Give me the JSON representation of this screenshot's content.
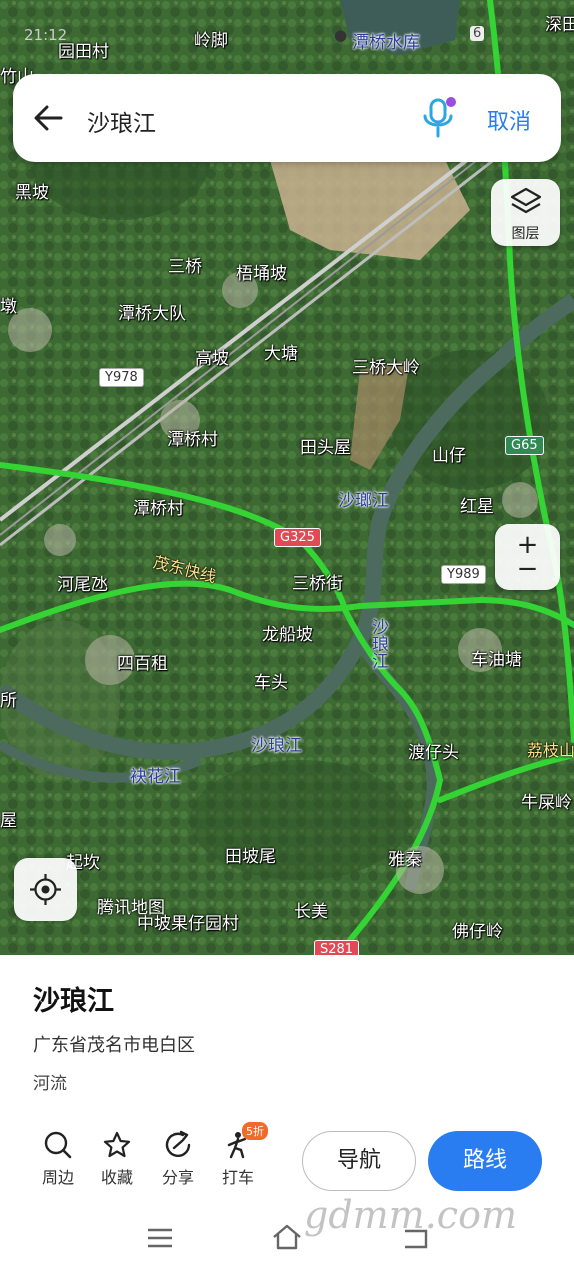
{
  "status_bar": {
    "time": "21:12",
    "carrier_label": "潭桥水库",
    "battery": "6"
  },
  "search": {
    "query": "沙琅江",
    "cancel_label": "取消"
  },
  "map_controls": {
    "layers_label": "图层",
    "zoom_in_symbol": "+",
    "zoom_out_symbol": "−",
    "watermark": "腾讯地图"
  },
  "map_labels": {
    "places": [
      "园田村",
      "岭脚",
      "深田",
      "竹山",
      "黑坡",
      "三桥",
      "梧埇坡",
      "潭桥大队",
      "高坡",
      "大塘",
      "三桥大岭",
      "潭桥村",
      "田头屋",
      "山仔",
      "红星",
      "潭桥村",
      "河尾氹",
      "三桥街",
      "龙船坡",
      "车油塘",
      "四百租",
      "车头",
      "渡仔头",
      "荔枝山",
      "牛屎岭",
      "田坡尾",
      "雅秦",
      "起坎",
      "长美",
      "中坡果仔园村",
      "佛仔岭",
      "屋",
      "所",
      "墩"
    ],
    "water": [
      "沙瑯江",
      "沙琅江",
      "沙琅江",
      "袂花江"
    ],
    "roads": [
      "茂东快线"
    ],
    "shields": {
      "y978": "Y978",
      "g325": "G325",
      "g65": "G65",
      "y989": "Y989",
      "s281": "S281"
    }
  },
  "place": {
    "name": "沙琅江",
    "address": "广东省茂名市电白区",
    "type": "河流"
  },
  "actions": [
    {
      "label": "周边",
      "icon": "search-icon"
    },
    {
      "label": "收藏",
      "icon": "star-icon"
    },
    {
      "label": "分享",
      "icon": "share-icon"
    },
    {
      "label": "打车",
      "icon": "taxi-icon",
      "badge": "5折"
    }
  ],
  "buttons": {
    "navigate": "导航",
    "route": "路线"
  },
  "site_watermark": "gdmm.com",
  "colors": {
    "accent": "#2a7df0",
    "route_green": "#33d433",
    "river": "#4d6a5e"
  }
}
